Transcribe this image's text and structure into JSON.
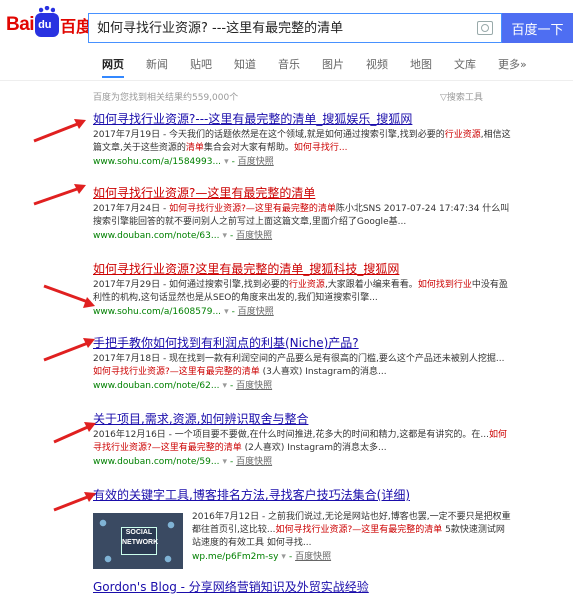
{
  "logo": {
    "latin": "Bai",
    "paw": "du",
    "chinese": "百度"
  },
  "search": {
    "query": "如何寻找行业资源? ---这里有最完整的清单",
    "button": "百度一下"
  },
  "tabs": [
    "网页",
    "新闻",
    "贴吧",
    "知道",
    "音乐",
    "图片",
    "视频",
    "地图",
    "文库",
    "更多»"
  ],
  "stats": {
    "count": "百度为您找到相关结果约559,000个",
    "tools": "搜索工具"
  },
  "results": [
    {
      "title": "如何寻找行业资源?---这里有最完整的清单_搜狐娱乐_搜狐网",
      "abstract_pre": "2017年7月19日 - 今天我们的话题依然是在这个领域,就是如何通过搜索引擎,找到必要的",
      "abstract_hl1": "行业资源",
      "abstract_mid": ",相信这篇文章,关于这些资源的",
      "abstract_hl2": "清单",
      "abstract_post": "集合会对大家有帮助。",
      "abstract_hl3": "如何寻找行...",
      "url": "www.sohu.com/a/1584993...",
      "snapshot": "百度快照"
    },
    {
      "title": "如何寻找行业资源?—这里有最完整的清单",
      "abstract_pre": "2017年7月24日 - ",
      "abstract_hl1": "如何寻找行业资源?—这里有最完整的清单",
      "abstract_mid": "陈小北SNS 2017-07-24 17:47:34 什么叫搜索引擎能回答的就不要问别人之前写过上面这篇文章,里面介绍了Google基...",
      "url": "www.douban.com/note/63...",
      "snapshot": "百度快照"
    },
    {
      "title": "如何寻找行业资源?这里有最完整的清单_搜狐科技_搜狐网",
      "abstract_pre": "2017年7月29日 - 如何通过搜索引擎,找到必要的",
      "abstract_hl1": "行业资源",
      "abstract_mid": ",大家跟着小编来看看。",
      "abstract_hl2": "如何找到行业",
      "abstract_post": "中没有盈利性的机构,这句话显然也是从SEO的角度来出发的,我们知道搜索引擎...",
      "url": "www.sohu.com/a/1608579...",
      "snapshot": "百度快照"
    },
    {
      "title": "手把手教你如何找到有利润点的利基(Niche)产品?",
      "abstract_pre": "2017年7月18日 - 现在找到一款有利润空间的产品要么是有很高的门槛,要么这个产品还未被别人挖掘...",
      "abstract_hl1": "如何寻找行业资源?—这里有最完整的清单",
      "abstract_mid": " (3人喜欢) Instagram的消息...",
      "url": "www.douban.com/note/62...",
      "snapshot": "百度快照"
    },
    {
      "title": "关于项目,需求,资源,如何辨识取舍与整合",
      "abstract_pre": "2016年12月16日 - 一个项目要不要做,在什么时间推进,花多大的时间和精力,这都是有讲究的。在...",
      "abstract_hl1": "如何寻找行业资源?—这里有最完整的清单",
      "abstract_mid": " (2人喜欢) Instagram的消息太多...",
      "url": "www.douban.com/note/59...",
      "snapshot": "百度快照"
    },
    {
      "title": "有效的关键字工具,博客排名方法,寻找客户技巧法集合(详细)",
      "abstract_pre": "2016年7月12日 - 之前我们说过,无论是网站也好,博客也罢,一定不要只是把权重都往首页引,这比较...",
      "abstract_hl1": "如何寻找行业资源?—这里有最完整的清单",
      "abstract_mid": " 5款快速测试网站速度的有效工具 如何寻找...",
      "url": "wp.me/p6Fm2m-sy",
      "snapshot": "百度快照",
      "thumb_text": "SOCIAL NETWORK"
    },
    {
      "title": "Gordon's Blog - 分享网络营销知识及外贸实战经验"
    }
  ]
}
